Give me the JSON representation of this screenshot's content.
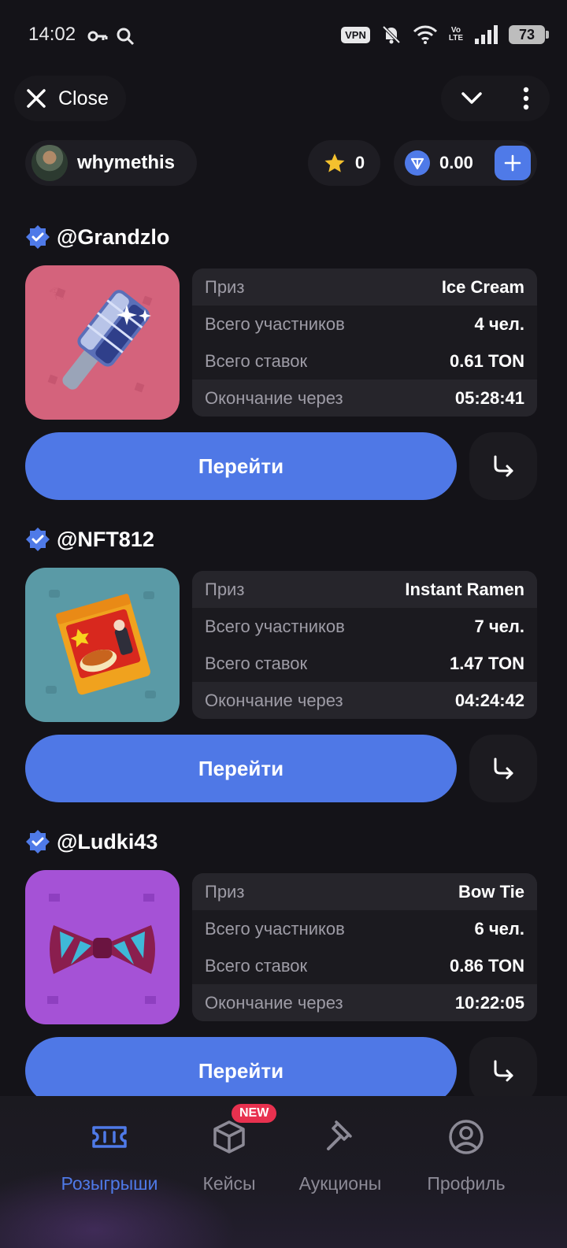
{
  "status_bar": {
    "time": "14:02",
    "vpn": "VPN",
    "volte_top": "Vo",
    "volte_bottom": "LTE",
    "battery": "73"
  },
  "header": {
    "close_label": "Close",
    "icons": [
      "close-icon",
      "chevron-down-icon",
      "more-vertical-icon"
    ]
  },
  "account": {
    "username": "whymethis",
    "stars": "0",
    "ton_balance": "0.00"
  },
  "giveaways": [
    {
      "owner": "@Grandzlo",
      "rows": [
        {
          "key": "Приз",
          "value": "Ice Cream"
        },
        {
          "key": "Всего участников",
          "value": "4 чел."
        },
        {
          "key": "Всего ставок",
          "value": "0.61 TON"
        },
        {
          "key": "Окончание через",
          "value": "05:28:41"
        }
      ],
      "button_label": "Перейти",
      "image_bg": "#d4637c"
    },
    {
      "owner": "@NFT812",
      "rows": [
        {
          "key": "Приз",
          "value": "Instant Ramen"
        },
        {
          "key": "Всего участников",
          "value": "7 чел."
        },
        {
          "key": "Всего ставок",
          "value": "1.47 TON"
        },
        {
          "key": "Окончание через",
          "value": "04:24:42"
        }
      ],
      "button_label": "Перейти",
      "image_bg": "#5a9aa6"
    },
    {
      "owner": "@Ludki43",
      "rows": [
        {
          "key": "Приз",
          "value": "Bow Tie"
        },
        {
          "key": "Всего участников",
          "value": "6 чел."
        },
        {
          "key": "Всего ставок",
          "value": "0.86 TON"
        },
        {
          "key": "Окончание через",
          "value": "10:22:05"
        }
      ],
      "button_label": "Перейти",
      "image_bg": "#a552d6"
    }
  ],
  "bottom_nav": {
    "items": [
      {
        "label": "Розыгрыши",
        "icon": "ticket-icon",
        "active": true
      },
      {
        "label": "Кейсы",
        "icon": "box-icon",
        "badge": "NEW"
      },
      {
        "label": "Аукционы",
        "icon": "gavel-icon"
      },
      {
        "label": "Профиль",
        "icon": "profile-icon"
      }
    ]
  },
  "colors": {
    "accent": "#4f7ae8",
    "background": "#141318",
    "badge_red": "#e8314f"
  }
}
